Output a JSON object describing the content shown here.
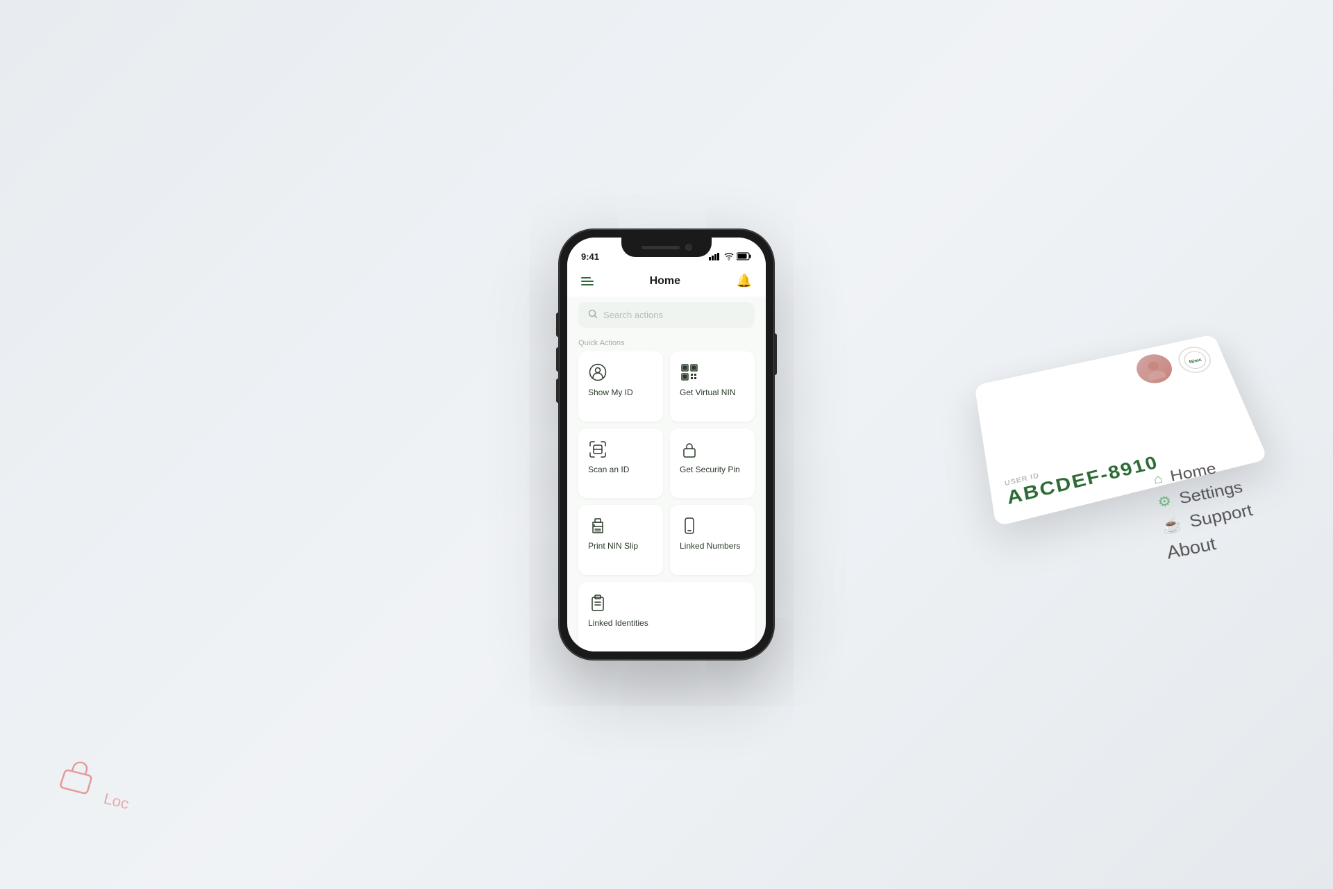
{
  "background": {
    "color": "#edf0f4"
  },
  "status_bar": {
    "time": "9:41",
    "signal": "▌▌▌",
    "wifi": "WiFi",
    "battery": "Battery"
  },
  "header": {
    "title": "Home",
    "menu_icon": "hamburger",
    "notification_icon": "bell"
  },
  "search": {
    "placeholder": "Search actions"
  },
  "quick_actions": {
    "label": "Quick Actions",
    "items": [
      {
        "id": "show-my-id",
        "label": "Show My ID",
        "icon": "person-circle"
      },
      {
        "id": "get-virtual-nin",
        "label": "Get Virtual NIN",
        "icon": "qr-grid"
      },
      {
        "id": "scan-an-id",
        "label": "Scan an ID",
        "icon": "scan-box"
      },
      {
        "id": "get-security-pin",
        "label": "Get Security Pin",
        "icon": "lock"
      },
      {
        "id": "print-nin-slip",
        "label": "Print NIN Slip",
        "icon": "printer"
      },
      {
        "id": "linked-numbers",
        "label": "Linked Numbers",
        "icon": "phone"
      },
      {
        "id": "linked-identities",
        "label": "Linked Identities",
        "icon": "clipboard"
      }
    ]
  },
  "card": {
    "user_id_label": "USER ID",
    "user_id_value": "ABCDEF-8910"
  },
  "floating_menu": {
    "items": [
      {
        "label": "Home",
        "icon": "home"
      },
      {
        "label": "Settings",
        "icon": "settings"
      },
      {
        "label": "Support",
        "icon": "support"
      },
      {
        "label": "About",
        "icon": "about"
      }
    ]
  }
}
